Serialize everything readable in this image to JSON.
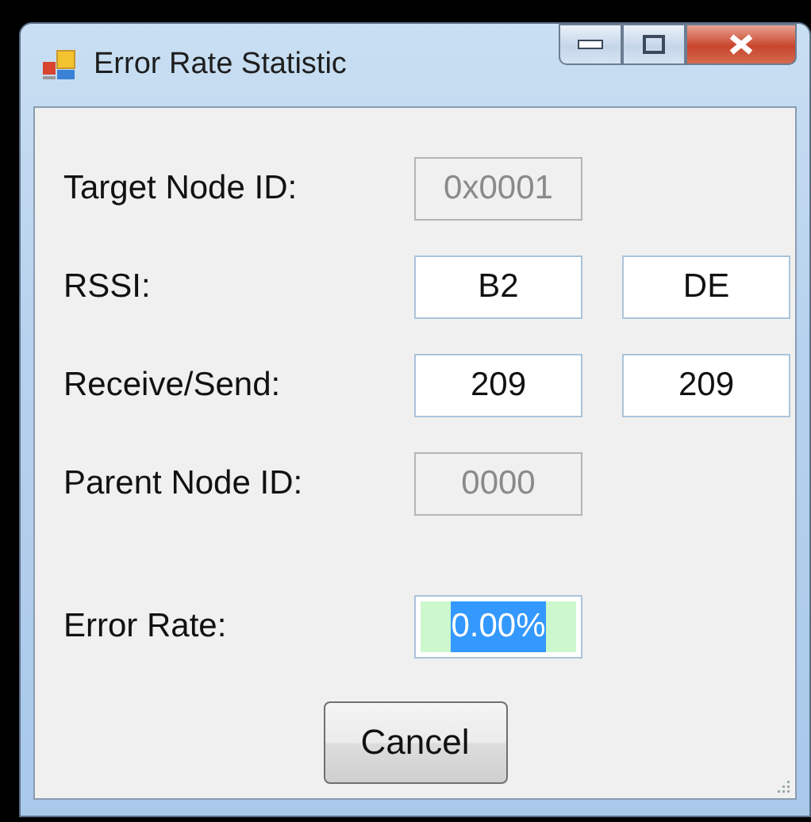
{
  "window": {
    "title": "Error Rate Statistic"
  },
  "rows": [
    {
      "label": "Target Node ID:",
      "fields": [
        {
          "value": "0x0001",
          "disabled": true,
          "selected": false
        }
      ]
    },
    {
      "label": "RSSI:",
      "fields": [
        {
          "value": "B2",
          "disabled": false,
          "selected": false
        },
        {
          "value": "DE",
          "disabled": false,
          "selected": false
        }
      ]
    },
    {
      "label": "Receive/Send:",
      "fields": [
        {
          "value": "209",
          "disabled": false,
          "selected": false
        },
        {
          "value": "209",
          "disabled": false,
          "selected": false
        }
      ]
    },
    {
      "label": "Parent Node ID:",
      "fields": [
        {
          "value": "0000",
          "disabled": true,
          "selected": false
        }
      ]
    },
    {
      "label": "Error Rate:",
      "fields": [
        {
          "value": "0.00%",
          "disabled": false,
          "selected": true
        }
      ]
    }
  ],
  "buttons": [
    "Cancel"
  ]
}
